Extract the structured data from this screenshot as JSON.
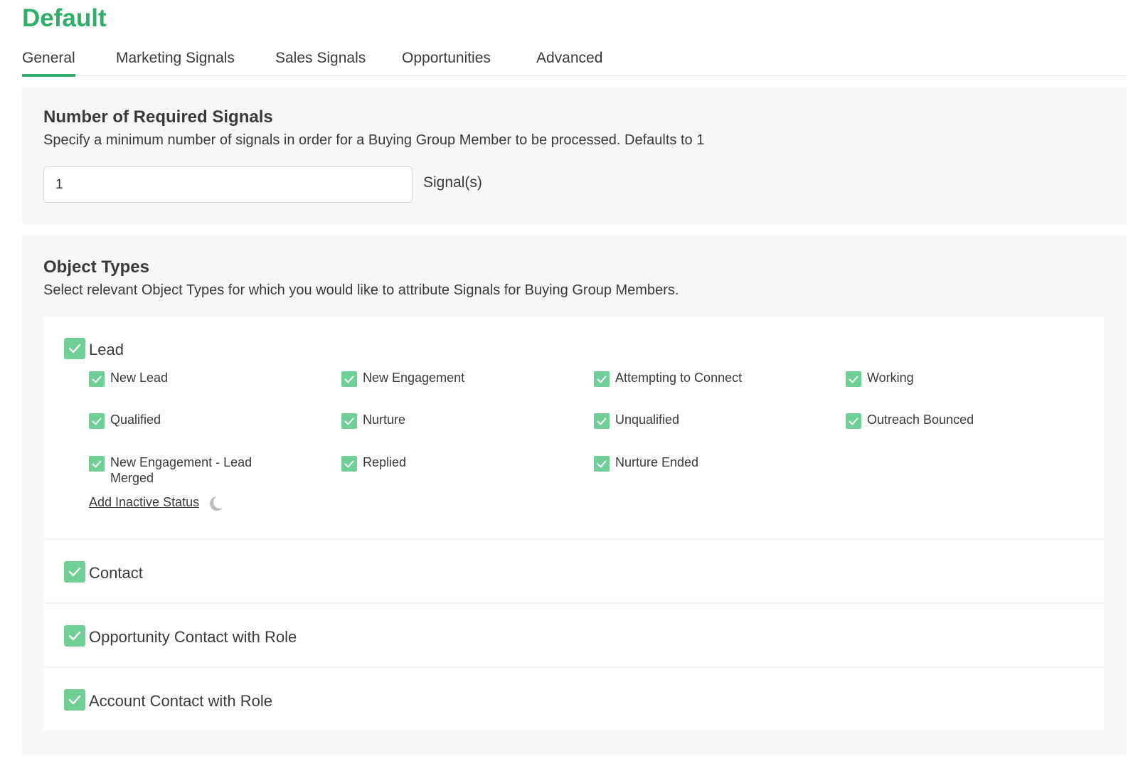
{
  "page": {
    "title": "Default"
  },
  "tabs": [
    {
      "label": "General",
      "active": true
    },
    {
      "label": "Marketing Signals",
      "active": false
    },
    {
      "label": "Sales Signals",
      "active": false
    },
    {
      "label": "Opportunities",
      "active": false
    },
    {
      "label": "Advanced",
      "active": false
    }
  ],
  "signals_panel": {
    "title": "Number of Required Signals",
    "description": "Specify a minimum number of signals in order for a Buying Group Member to be processed. Defaults to 1",
    "input_value": "1",
    "unit_label": "Signal(s)"
  },
  "object_types_panel": {
    "title": "Object Types",
    "description": "Select relevant Object Types for which you would like to attribute Signals for Buying Group Members.",
    "lead": {
      "label": "Lead",
      "checked": true,
      "statuses": [
        {
          "label": "New Lead",
          "checked": true
        },
        {
          "label": "New Engagement",
          "checked": true
        },
        {
          "label": "Attempting to Connect",
          "checked": true
        },
        {
          "label": "Working",
          "checked": true
        },
        {
          "label": "Qualified",
          "checked": true
        },
        {
          "label": "Nurture",
          "checked": true
        },
        {
          "label": "Unqualified",
          "checked": true
        },
        {
          "label": "Outreach Bounced",
          "checked": true
        },
        {
          "label": "New Engagement - Lead Merged",
          "checked": true
        },
        {
          "label": "Replied",
          "checked": true
        },
        {
          "label": "Nurture Ended",
          "checked": true
        }
      ],
      "add_inactive_label": "Add Inactive Status",
      "add_inactive_icon": "moon-icon"
    },
    "other_types": [
      {
        "label": "Contact",
        "checked": true
      },
      {
        "label": "Opportunity Contact with Role",
        "checked": true
      },
      {
        "label": "Account Contact with Role",
        "checked": true
      }
    ]
  },
  "colors": {
    "accent": "#2eaf6a",
    "checkbox": "#6fcf97",
    "panel_bg": "#f7f7f7"
  }
}
